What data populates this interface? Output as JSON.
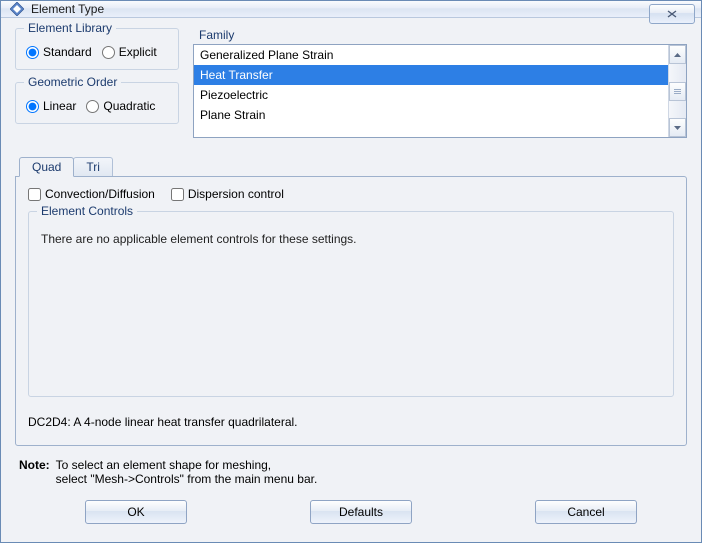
{
  "window": {
    "title": "Element Type",
    "close_tooltip": "Close"
  },
  "element_library": {
    "legend": "Element Library",
    "options": {
      "standard": "Standard",
      "explicit": "Explicit"
    },
    "selected": "standard"
  },
  "geometric_order": {
    "legend": "Geometric Order",
    "options": {
      "linear": "Linear",
      "quadratic": "Quadratic"
    },
    "selected": "linear"
  },
  "family": {
    "legend": "Family",
    "items": [
      "Generalized Plane Strain",
      "Heat Transfer",
      "Piezoelectric",
      "Plane Strain"
    ],
    "selected_index": 1
  },
  "tabs": {
    "items": [
      "Quad",
      "Tri"
    ],
    "active_index": 0
  },
  "quad_panel": {
    "checkboxes": {
      "convection_diffusion": "Convection/Diffusion",
      "dispersion_control": "Dispersion control"
    },
    "checked": {
      "convection_diffusion": false,
      "dispersion_control": false
    },
    "element_controls_legend": "Element Controls",
    "element_controls_msg": "There are no applicable element controls for these settings.",
    "element_description": "DC2D4:  A 4-node linear heat transfer quadrilateral."
  },
  "note": {
    "label": "Note:",
    "line1": "To select an element shape for meshing,",
    "line2": "select \"Mesh->Controls\" from the main menu bar."
  },
  "buttons": {
    "ok": "OK",
    "defaults": "Defaults",
    "cancel": "Cancel"
  }
}
